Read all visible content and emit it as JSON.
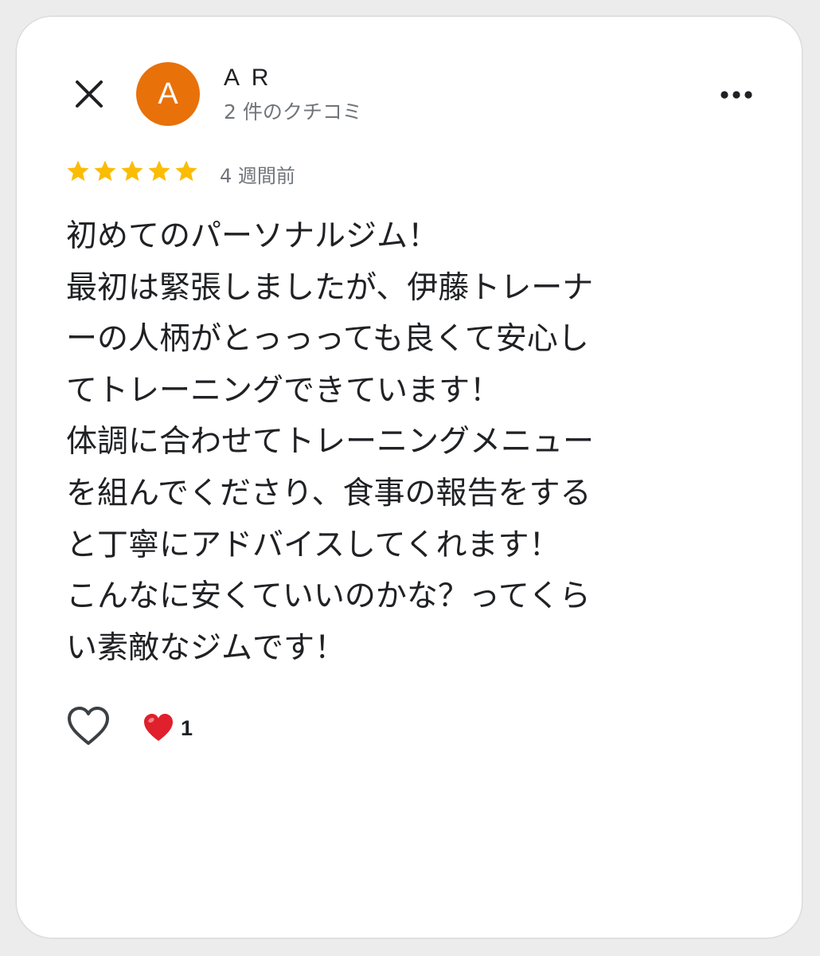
{
  "header": {
    "avatar_letter": "A",
    "avatar_color": "#e8710a",
    "author_name": "A R",
    "review_count": "2 件のクチコミ"
  },
  "icons": {
    "close": "close-icon",
    "more": "more-horizontal-icon",
    "like": "heart-outline-icon",
    "reaction": "red-heart-icon",
    "star": "star-icon"
  },
  "review": {
    "rating": 5,
    "max_rating": 5,
    "star_color": "#fbbc04",
    "time_ago": "4 週間前",
    "lines": [
      "初めてのパーソナルジム！",
      "最初は緊張しましたが、伊藤トレーナ",
      "ーの人柄がとっっっても良くて安心し",
      "てトレーニングできています！",
      "体調に合わせてトレーニングメニュー",
      "を組んでくださり、食事の報告をする",
      "と丁寧にアドバイスしてくれます！",
      "こんなに安くていいのかな？ってくら",
      "い素敵なジムです！"
    ]
  },
  "reactions": {
    "heart_color": "#e0202c",
    "count": "1"
  }
}
